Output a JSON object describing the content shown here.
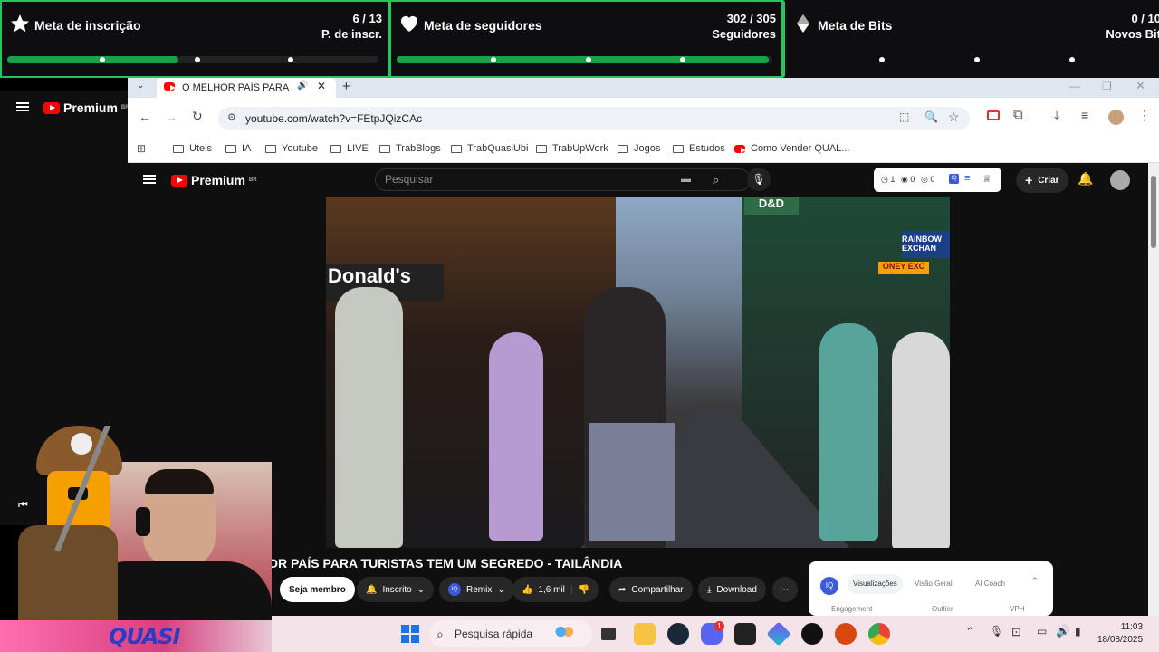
{
  "goals": [
    {
      "title": "Meta de inscrição",
      "count": "6 / 13",
      "unit": "P. de inscr.",
      "progress": 0.46
    },
    {
      "title": "Meta de seguidores",
      "count": "302 / 305",
      "unit": "Seguidores",
      "progress": 0.99
    },
    {
      "title": "Meta de Bits",
      "count": "0 / 10",
      "unit": "Novos Bit",
      "progress": 0.0
    }
  ],
  "left_strip": {
    "brand": "Premium",
    "region": "BR"
  },
  "browser": {
    "tab_title": "O MELHOR PAÍS PARA TURISTAS",
    "url": "youtube.com/watch?v=FEtpJQizCAc",
    "bookmarks": [
      "Uteis",
      "IA",
      "Youtube",
      "LIVE",
      "TrabBlogs",
      "TrabQuasiUbi",
      "TrabUpWork",
      "Jogos",
      "Estudos",
      "Como Vender QUAL..."
    ]
  },
  "yt": {
    "brand": "Premium",
    "region": "BR",
    "search_placeholder": "Pesquisar",
    "ext_counts": [
      "1",
      "0",
      "0"
    ],
    "create_label": "Criar",
    "video_title": "HOR PAÍS PARA TURISTAS TEM UM SEGREDO - TAILÂNDIA",
    "member_label": "Seja membro",
    "subscribed_label": "Inscrito",
    "remix_label": "Remix",
    "likes": "1,6 mil",
    "share_label": "Compartilhar",
    "download_label": "Download",
    "panel_tabs": [
      "Visualizações",
      "Visão Geral",
      "AI Coach"
    ],
    "panel_labels": [
      "Engagement",
      "Outlier",
      "VPH"
    ],
    "panel_badge": "IQ"
  },
  "video_signs": [
    "Donald's",
    "D&D",
    "EXCHAN",
    "RAINBOW",
    "ONEY EXC"
  ],
  "overlay": {
    "logo_text": "QUASI"
  },
  "taskbar": {
    "search_placeholder": "Pesquisa rápida",
    "time": "11:03",
    "date": "18/08/2025",
    "badge": "1"
  }
}
